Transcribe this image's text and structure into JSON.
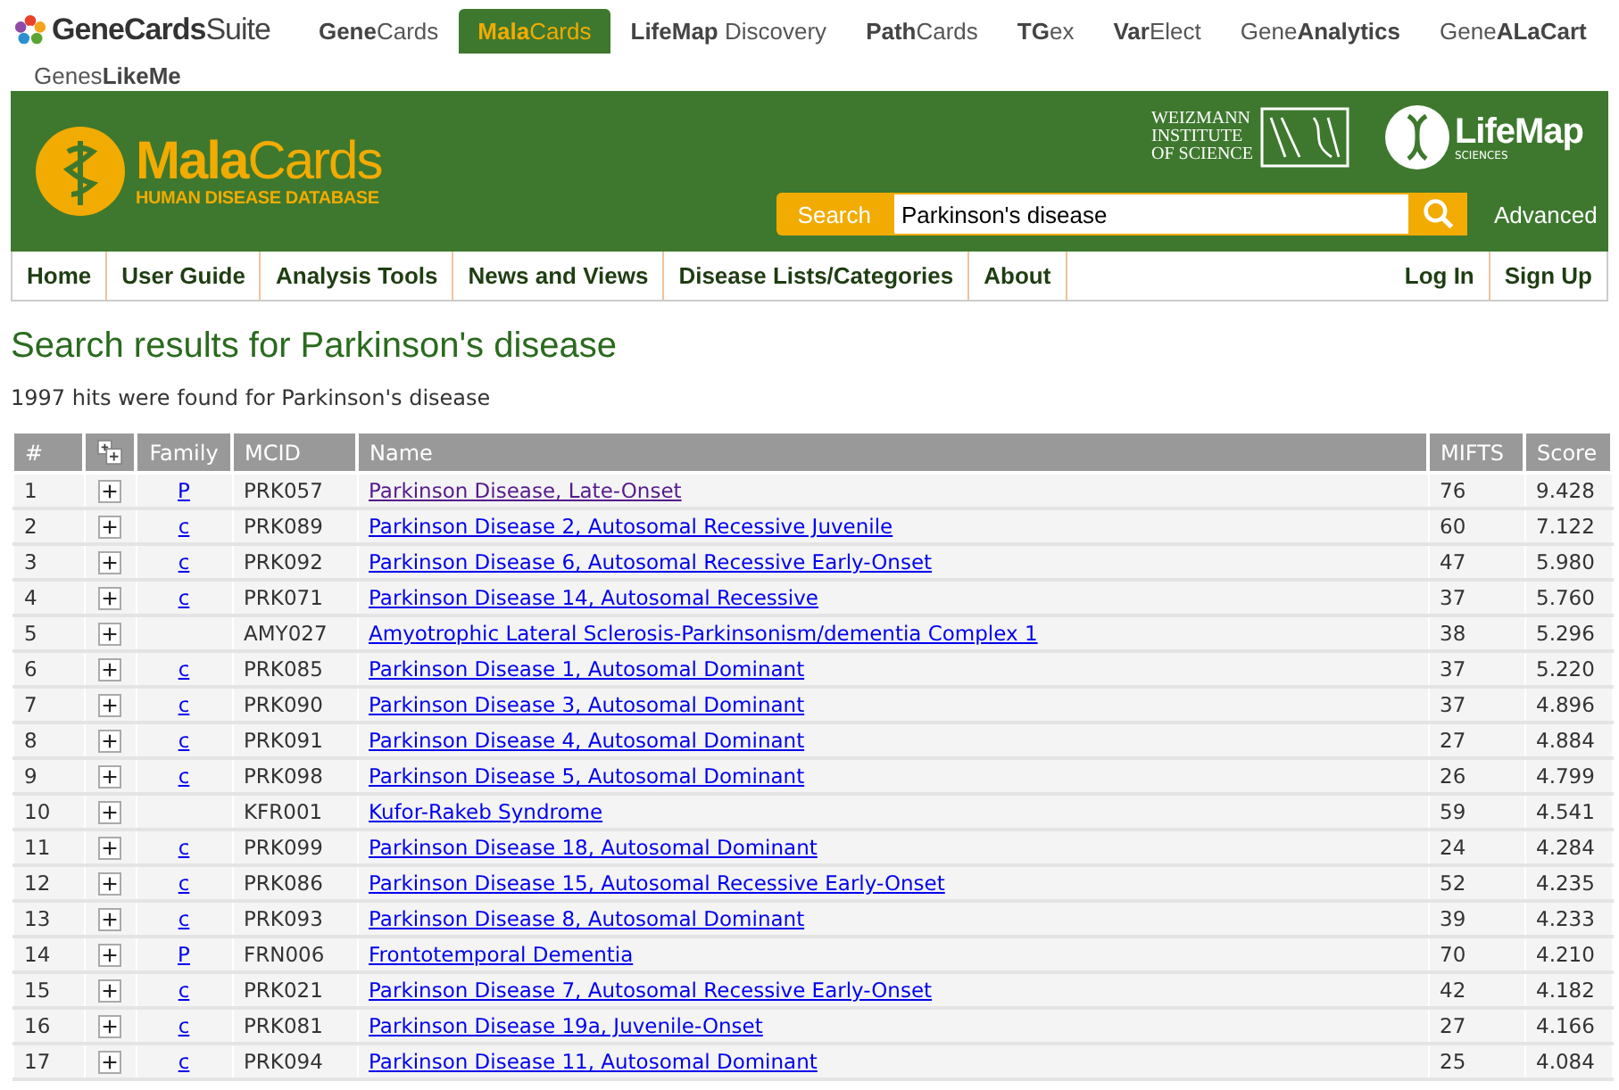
{
  "suite_bar": {
    "logo": "**GeneCards**Suite",
    "tabs": [
      {
        "label": "**Gene**Cards",
        "selected": false
      },
      {
        "label": "**Mala**Cards",
        "selected": true
      },
      {
        "label": "**LifeMap** Discovery",
        "selected": false
      },
      {
        "label": "**Path**Cards",
        "selected": false
      },
      {
        "label": "**TG**ex",
        "selected": false
      },
      {
        "label": "**Var**Elect",
        "selected": false
      },
      {
        "label": "Gene**Analytics**",
        "selected": false
      },
      {
        "label": "Gene**ALaCart**",
        "selected": false
      },
      {
        "label": "Genes**LikeMe**",
        "selected": false
      }
    ]
  },
  "header": {
    "logo_title_bold": "Mala",
    "logo_title_rest": "Cards",
    "logo_subtitle": "HUMAN DISEASE DATABASE",
    "partner_1": [
      "WEIZMANN",
      "INSTITUTE",
      "OF SCIENCE"
    ],
    "partner_2": {
      "name": "LifeMap",
      "sub": "SCIENCES"
    },
    "search": {
      "button": "Search",
      "value": "Parkinson's disease",
      "advanced": "Advanced"
    }
  },
  "nav": {
    "left": [
      "Home",
      "User Guide",
      "Analysis Tools",
      "News and Views",
      "Disease Lists/Categories",
      "About"
    ],
    "right": [
      "Log In",
      "Sign Up"
    ]
  },
  "title": "Search results for Parkinson's disease",
  "summary": "1997 hits were found for Parkinson's disease",
  "table": {
    "columns": [
      "#",
      "Family",
      "MCID",
      "Name",
      "MIFTS",
      "Score"
    ],
    "rows": [
      {
        "n": "1",
        "family": "P",
        "mcid": "PRK057",
        "name": "Parkinson Disease, Late-Onset",
        "visited": true,
        "mifts": "76",
        "score": "9.428"
      },
      {
        "n": "2",
        "family": "c",
        "mcid": "PRK089",
        "name": "Parkinson Disease 2, Autosomal Recessive Juvenile",
        "visited": false,
        "mifts": "60",
        "score": "7.122"
      },
      {
        "n": "3",
        "family": "c",
        "mcid": "PRK092",
        "name": "Parkinson Disease 6, Autosomal Recessive Early-Onset",
        "visited": false,
        "mifts": "47",
        "score": "5.980"
      },
      {
        "n": "4",
        "family": "c",
        "mcid": "PRK071",
        "name": "Parkinson Disease 14, Autosomal Recessive",
        "visited": false,
        "mifts": "37",
        "score": "5.760"
      },
      {
        "n": "5",
        "mcid": "AMY027",
        "name": "Amyotrophic Lateral Sclerosis-Parkinsonism/dementia Complex 1",
        "visited": false,
        "mifts": "38",
        "score": "5.296"
      },
      {
        "n": "6",
        "family": "c",
        "mcid": "PRK085",
        "name": "Parkinson Disease 1, Autosomal Dominant",
        "visited": false,
        "mifts": "37",
        "score": "5.220"
      },
      {
        "n": "7",
        "family": "c",
        "mcid": "PRK090",
        "name": "Parkinson Disease 3, Autosomal Dominant",
        "visited": false,
        "mifts": "37",
        "score": "4.896"
      },
      {
        "n": "8",
        "family": "c",
        "mcid": "PRK091",
        "name": "Parkinson Disease 4, Autosomal Dominant",
        "visited": false,
        "mifts": "27",
        "score": "4.884"
      },
      {
        "n": "9",
        "family": "c",
        "mcid": "PRK098",
        "name": "Parkinson Disease 5, Autosomal Dominant",
        "visited": false,
        "mifts": "26",
        "score": "4.799"
      },
      {
        "n": "10",
        "mcid": "KFR001",
        "name": "Kufor-Rakeb Syndrome",
        "visited": false,
        "mifts": "59",
        "score": "4.541"
      },
      {
        "n": "11",
        "family": "c",
        "mcid": "PRK099",
        "name": "Parkinson Disease 18, Autosomal Dominant",
        "visited": false,
        "mifts": "24",
        "score": "4.284"
      },
      {
        "n": "12",
        "family": "c",
        "mcid": "PRK086",
        "name": "Parkinson Disease 15, Autosomal Recessive Early-Onset",
        "visited": false,
        "mifts": "52",
        "score": "4.235"
      },
      {
        "n": "13",
        "family": "c",
        "mcid": "PRK093",
        "name": "Parkinson Disease 8, Autosomal Dominant",
        "visited": false,
        "mifts": "39",
        "score": "4.233"
      },
      {
        "n": "14",
        "family": "P",
        "mcid": "FRN006",
        "name": "Frontotemporal Dementia",
        "visited": false,
        "mifts": "70",
        "score": "4.210"
      },
      {
        "n": "15",
        "family": "c",
        "mcid": "PRK021",
        "name": "Parkinson Disease 7, Autosomal Recessive Early-Onset",
        "visited": false,
        "mifts": "42",
        "score": "4.182"
      },
      {
        "n": "16",
        "family": "c",
        "mcid": "PRK081",
        "name": "Parkinson Disease 19a, Juvenile-Onset",
        "visited": false,
        "mifts": "27",
        "score": "4.166"
      },
      {
        "n": "17",
        "family": "c",
        "mcid": "PRK094",
        "name": "Parkinson Disease 11, Autosomal Dominant",
        "visited": false,
        "mifts": "25",
        "score": "4.084"
      }
    ]
  }
}
